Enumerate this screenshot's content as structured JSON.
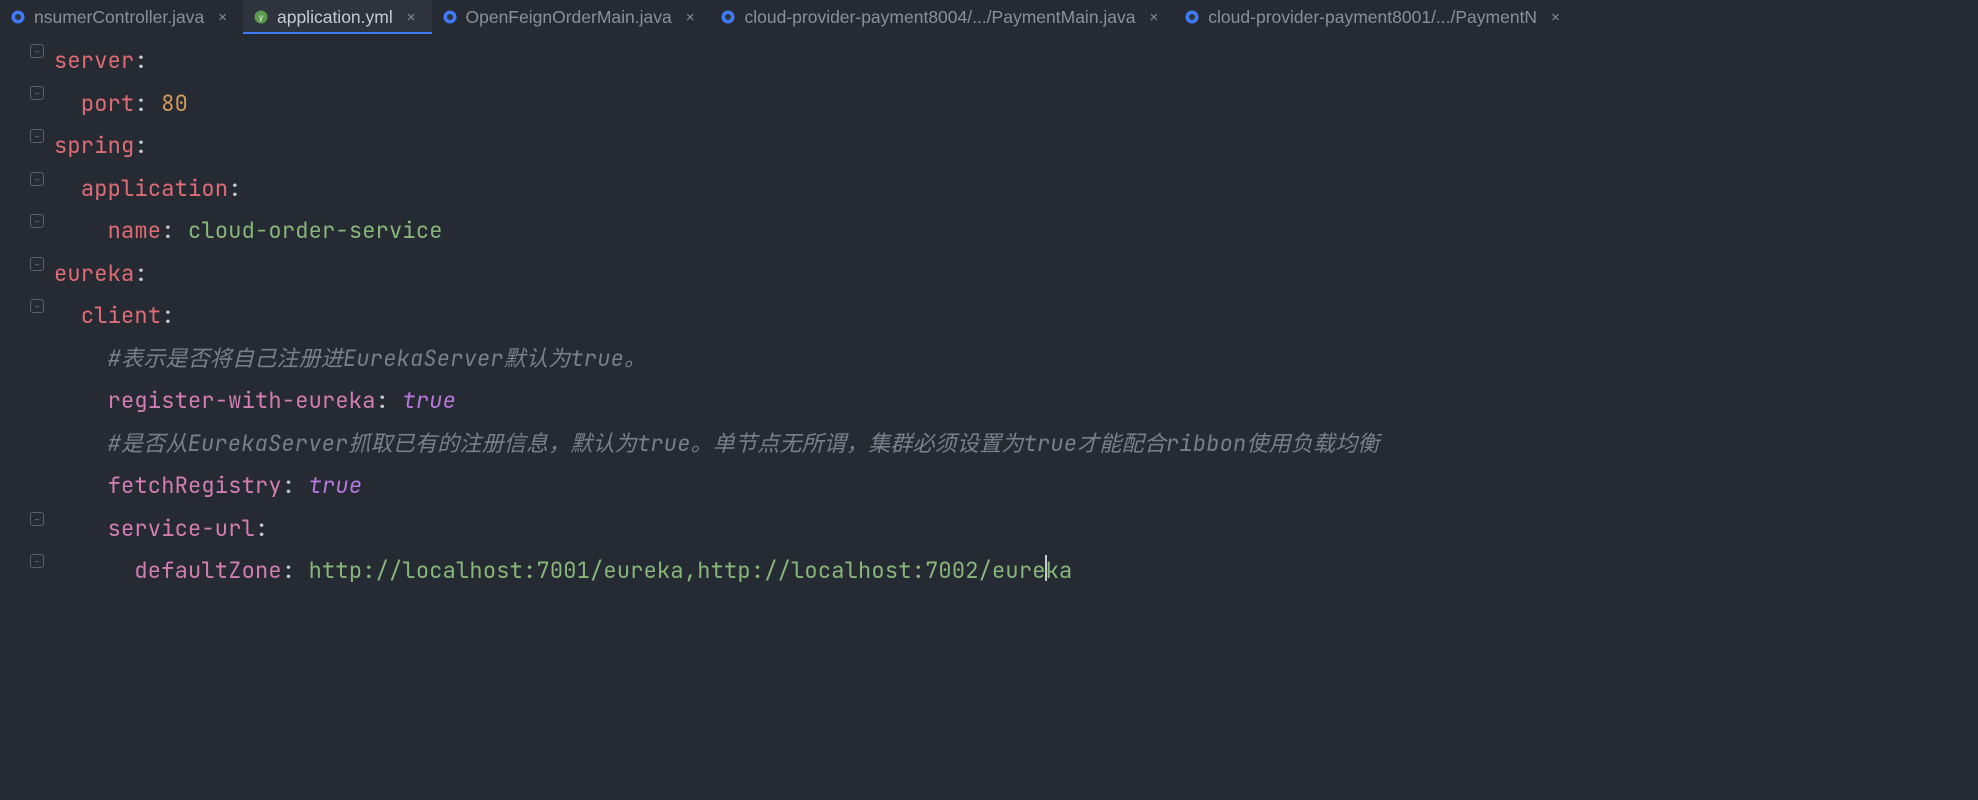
{
  "tabs": [
    {
      "label": "nsumerController.java",
      "type": "java",
      "active": false
    },
    {
      "label": "application.yml",
      "type": "yml",
      "active": true
    },
    {
      "label": "OpenFeignOrderMain.java",
      "type": "java",
      "active": false
    },
    {
      "label": "cloud-provider-payment8004/.../PaymentMain.java",
      "type": "java",
      "active": false
    },
    {
      "label": "cloud-provider-payment8001/.../PaymentN",
      "type": "java",
      "active": false
    }
  ],
  "code": {
    "l1_key": "server",
    "l2_key": "port",
    "l2_val": "80",
    "l3_key": "spring",
    "l4_key": "application",
    "l5_key": "name",
    "l5_val": "cloud-order-service",
    "l6_key": "eureka",
    "l7_key": "client",
    "l8_comment": "#表示是否将自己注册进EurekaServer默认为true。",
    "l9_key": "register-with-eureka",
    "l9_val": "true",
    "l10_comment": "#是否从EurekaServer抓取已有的注册信息，默认为true。单节点无所谓，集群必须设置为true才能配合ribbon使用负载均衡",
    "l11_key": "fetchRegistry",
    "l11_val": "true",
    "l12_key": "service-url",
    "l13_key": "defaultZone",
    "l13_val": "http://localhost:7001/eureka,http://localhost:7002/eure",
    "l13_val_tail": "ka"
  }
}
